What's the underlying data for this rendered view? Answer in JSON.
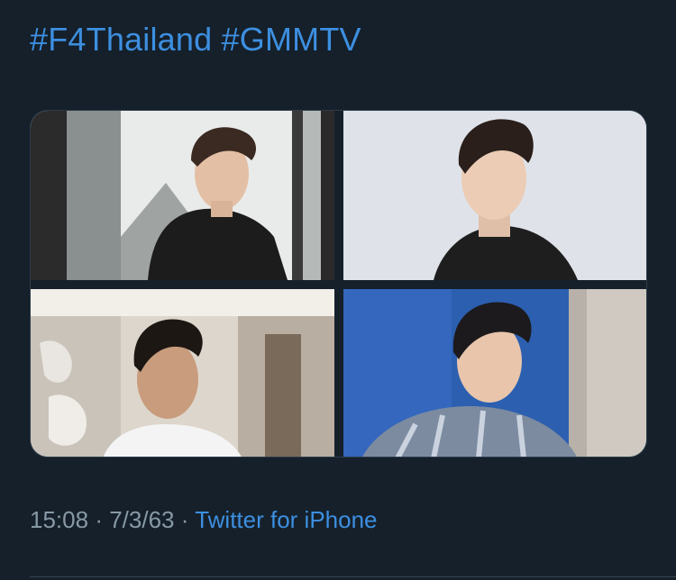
{
  "tweet": {
    "hashtags": [
      "#F4Thailand",
      "#GMMTV"
    ],
    "photos": [
      {
        "label": "photo-1",
        "description_icon": "person-photo-icon"
      },
      {
        "label": "photo-2",
        "description_icon": "person-photo-icon"
      },
      {
        "label": "photo-3",
        "description_icon": "person-photo-icon"
      },
      {
        "label": "photo-4",
        "description_icon": "person-photo-icon"
      }
    ],
    "time": "15:08",
    "separator": "·",
    "date": "7/3/63",
    "source": "Twitter for iPhone"
  },
  "colors": {
    "background": "#15202b",
    "link": "#3d8fe0",
    "muted": "#8899a6",
    "divider": "#38444d"
  }
}
